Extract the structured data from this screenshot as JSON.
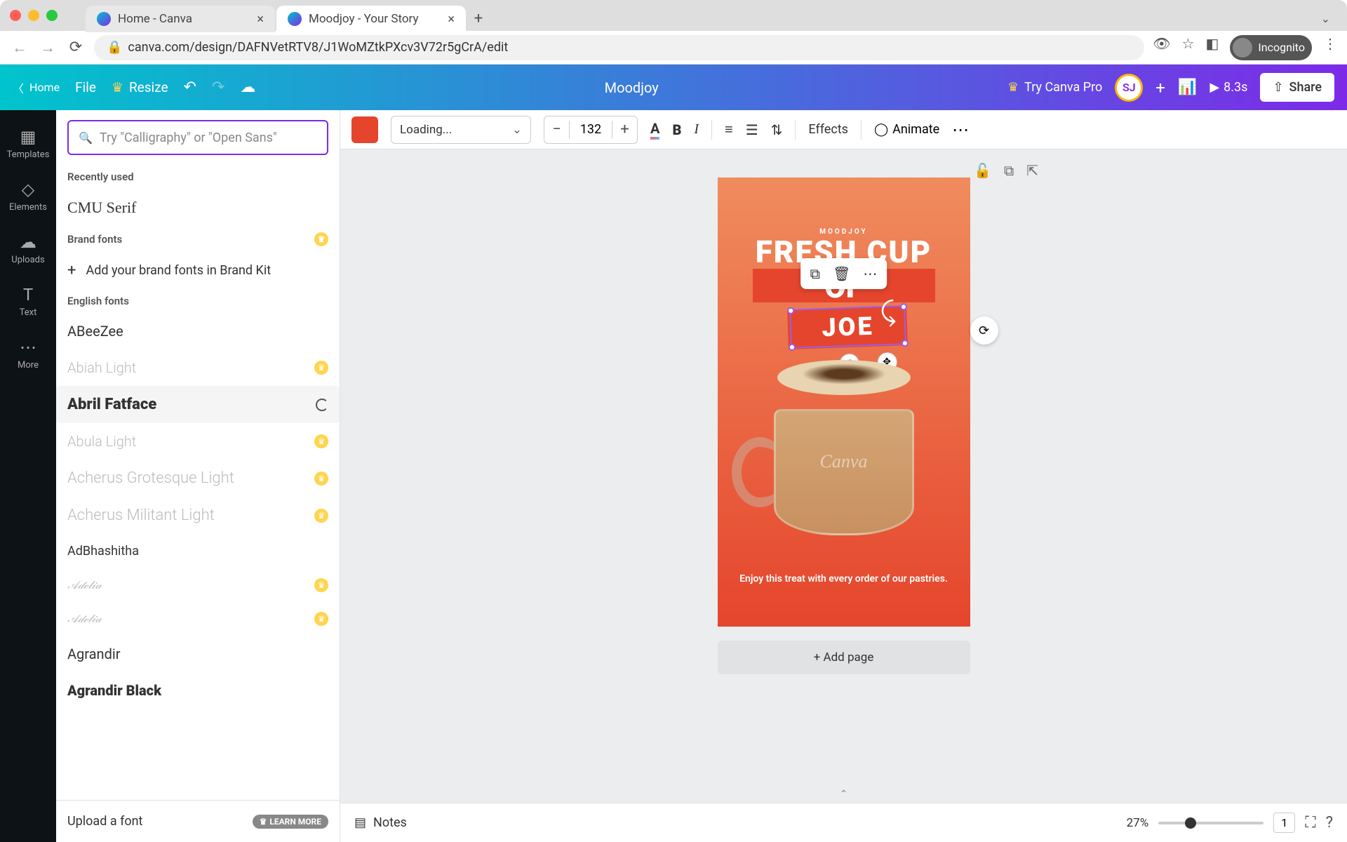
{
  "browser": {
    "tabs": [
      {
        "title": "Home - Canva"
      },
      {
        "title": "Moodjoy - Your Story"
      }
    ],
    "url": "canva.com/design/DAFNVetRTV8/J1WoMZtkPXcv3V72r5gCrA/edit",
    "incognito_label": "Incognito"
  },
  "header": {
    "home": "Home",
    "file": "File",
    "resize": "Resize",
    "doc_title": "Moodjoy",
    "try_pro": "Try Canva Pro",
    "avatar_initials": "SJ",
    "play_time": "8.3s",
    "share": "Share"
  },
  "rail": {
    "templates": "Templates",
    "elements": "Elements",
    "uploads": "Uploads",
    "text": "Text",
    "more": "More"
  },
  "font_panel": {
    "search_placeholder": "Try \"Calligraphy\" or \"Open Sans\"",
    "recently_used": "Recently used",
    "cmu_serif": "CMU Serif",
    "brand_fonts": "Brand fonts",
    "add_brand_fonts": "Add your brand fonts in Brand Kit",
    "english_fonts": "English fonts",
    "fonts": {
      "abeezee": "ABeeZee",
      "abiah": "Abiah Light",
      "abril": "Abril Fatface",
      "abula": "Abula Light",
      "acherus_g": "Acherus Grotesque Light",
      "acherus_m": "Acherus Militant Light",
      "adbhashitha": "AdBhashitha",
      "adelia1": "Adelia",
      "adelia2": "Adelia",
      "agrandir": "Agrandir",
      "agrandir_black": "Agrandir Black"
    },
    "upload_font": "Upload a font",
    "learn_more": "LEARN MORE"
  },
  "toolbar": {
    "font_name": "Loading...",
    "size": "132",
    "effects": "Effects",
    "animate": "Animate"
  },
  "canvas": {
    "moodjoy": "MOODJOY",
    "fresh_cup": "FRESH CUP",
    "of": "OF",
    "joe": "JOE",
    "watermark": "Canva",
    "description": "Enjoy this treat with every order of our pastries.",
    "add_page": "+ Add page"
  },
  "bottom": {
    "notes": "Notes",
    "zoom": "27%",
    "page": "1"
  }
}
